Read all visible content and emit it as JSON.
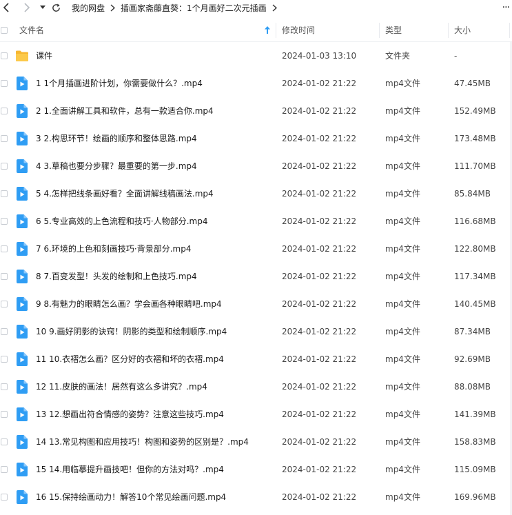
{
  "toolbar": {
    "breadcrumbs": [
      "我的网盘",
      "插画家斋藤直葵：1个月画好二次元插画"
    ],
    "more": "···"
  },
  "columns": {
    "name": "文件名",
    "date": "修改时间",
    "type": "类型",
    "size": "大小"
  },
  "files": [
    {
      "kind": "folder",
      "name": "课件",
      "date": "2024-01-03 13:10",
      "type": "文件夹",
      "size": "-"
    },
    {
      "kind": "video",
      "name": "1 1个月插画进阶计划，你需要做什么？.mp4",
      "date": "2024-01-02 21:22",
      "type": "mp4文件",
      "size": "47.45MB"
    },
    {
      "kind": "video",
      "name": "2 1.全面讲解工具和软件，总有一款适合你.mp4",
      "date": "2024-01-02 21:22",
      "type": "mp4文件",
      "size": "152.49MB"
    },
    {
      "kind": "video",
      "name": "3 2.构思环节！绘画的顺序和整体思路.mp4",
      "date": "2024-01-02 21:22",
      "type": "mp4文件",
      "size": "173.48MB"
    },
    {
      "kind": "video",
      "name": "4 3.草稿也要分步骤？最重要的第一步.mp4",
      "date": "2024-01-02 21:22",
      "type": "mp4文件",
      "size": "111.70MB"
    },
    {
      "kind": "video",
      "name": "5 4.怎样把线条画好看？全面讲解线稿画法.mp4",
      "date": "2024-01-02 21:22",
      "type": "mp4文件",
      "size": "85.84MB"
    },
    {
      "kind": "video",
      "name": "6 5.专业高效的上色流程和技巧·人物部分.mp4",
      "date": "2024-01-02 21:22",
      "type": "mp4文件",
      "size": "116.68MB"
    },
    {
      "kind": "video",
      "name": "7 6.环境的上色和刻画技巧·背景部分.mp4",
      "date": "2024-01-02 21:22",
      "type": "mp4文件",
      "size": "122.80MB"
    },
    {
      "kind": "video",
      "name": "8 7.百变发型！头发的绘制和上色技巧.mp4",
      "date": "2024-01-02 21:22",
      "type": "mp4文件",
      "size": "117.34MB"
    },
    {
      "kind": "video",
      "name": "9 8.有魅力的眼睛怎么画？学会画各种眼睛吧.mp4",
      "date": "2024-01-02 21:22",
      "type": "mp4文件",
      "size": "140.45MB"
    },
    {
      "kind": "video",
      "name": "10 9.画好阴影的诀窍！阴影的类型和绘制顺序.mp4",
      "date": "2024-01-02 21:22",
      "type": "mp4文件",
      "size": "87.34MB"
    },
    {
      "kind": "video",
      "name": "11 10.衣褶怎么画？区分好的衣褶和坏的衣褶.mp4",
      "date": "2024-01-02 21:22",
      "type": "mp4文件",
      "size": "92.69MB"
    },
    {
      "kind": "video",
      "name": "12 11.皮肤的画法！居然有这么多讲究？.mp4",
      "date": "2024-01-02 21:22",
      "type": "mp4文件",
      "size": "88.08MB"
    },
    {
      "kind": "video",
      "name": "13 12.想画出符合情感的姿势？注意这些技巧.mp4",
      "date": "2024-01-02 21:22",
      "type": "mp4文件",
      "size": "141.39MB"
    },
    {
      "kind": "video",
      "name": "14 13.常见构图和应用技巧！构图和姿势的区别是？.mp4",
      "date": "2024-01-02 21:22",
      "type": "mp4文件",
      "size": "158.83MB"
    },
    {
      "kind": "video",
      "name": "15 14.用临摹提升画技吧！但你的方法对吗？.mp4",
      "date": "2024-01-02 21:22",
      "type": "mp4文件",
      "size": "115.09MB"
    },
    {
      "kind": "video",
      "name": "16 15.保持绘画动力！解答10个常见绘画问题.mp4",
      "date": "2024-01-02 21:22",
      "type": "mp4文件",
      "size": "169.96MB"
    }
  ],
  "colors": {
    "folder": "#f7b731",
    "video": "#2f9df4",
    "sort_arrow": "#2f9df4"
  }
}
